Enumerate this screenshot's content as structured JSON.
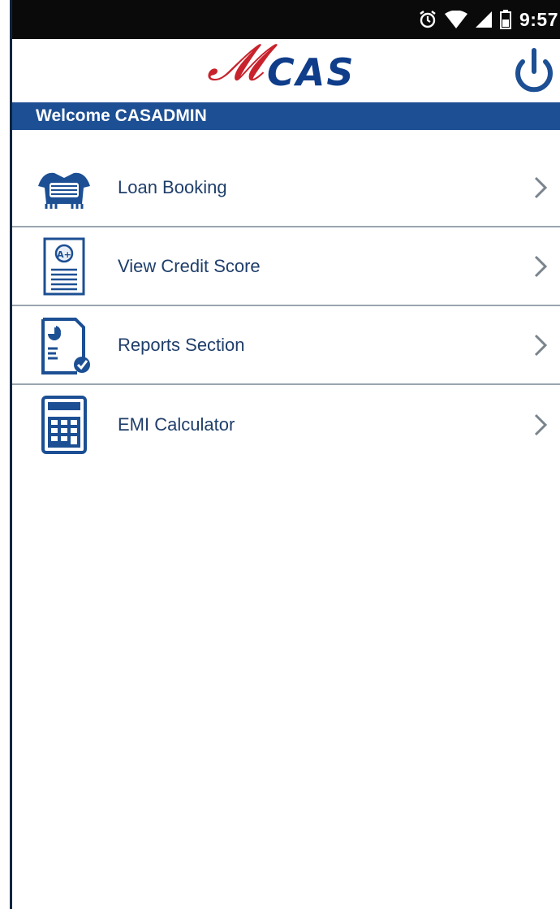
{
  "status_bar": {
    "icons": [
      "alarm-icon",
      "wifi-icon",
      "signal-icon",
      "battery-icon"
    ],
    "time": "9:57"
  },
  "header": {
    "logo_script": "𝓜",
    "logo_word": "CAS",
    "power_icon": "power-icon"
  },
  "welcome": {
    "text": "Welcome  CASADMIN"
  },
  "menu": {
    "items": [
      {
        "label": "Loan Booking",
        "icon": "handshake-icon"
      },
      {
        "label": "View Credit Score",
        "icon": "credit-score-icon"
      },
      {
        "label": "Reports Section",
        "icon": "report-icon"
      },
      {
        "label": "EMI Calculator",
        "icon": "calculator-icon"
      }
    ]
  },
  "colors": {
    "brand_blue": "#1c4f93",
    "logo_red": "#c8232c",
    "logo_blue": "#0f3d8a",
    "text_blue": "#1f3e6a",
    "divider": "#9aa6b0"
  }
}
